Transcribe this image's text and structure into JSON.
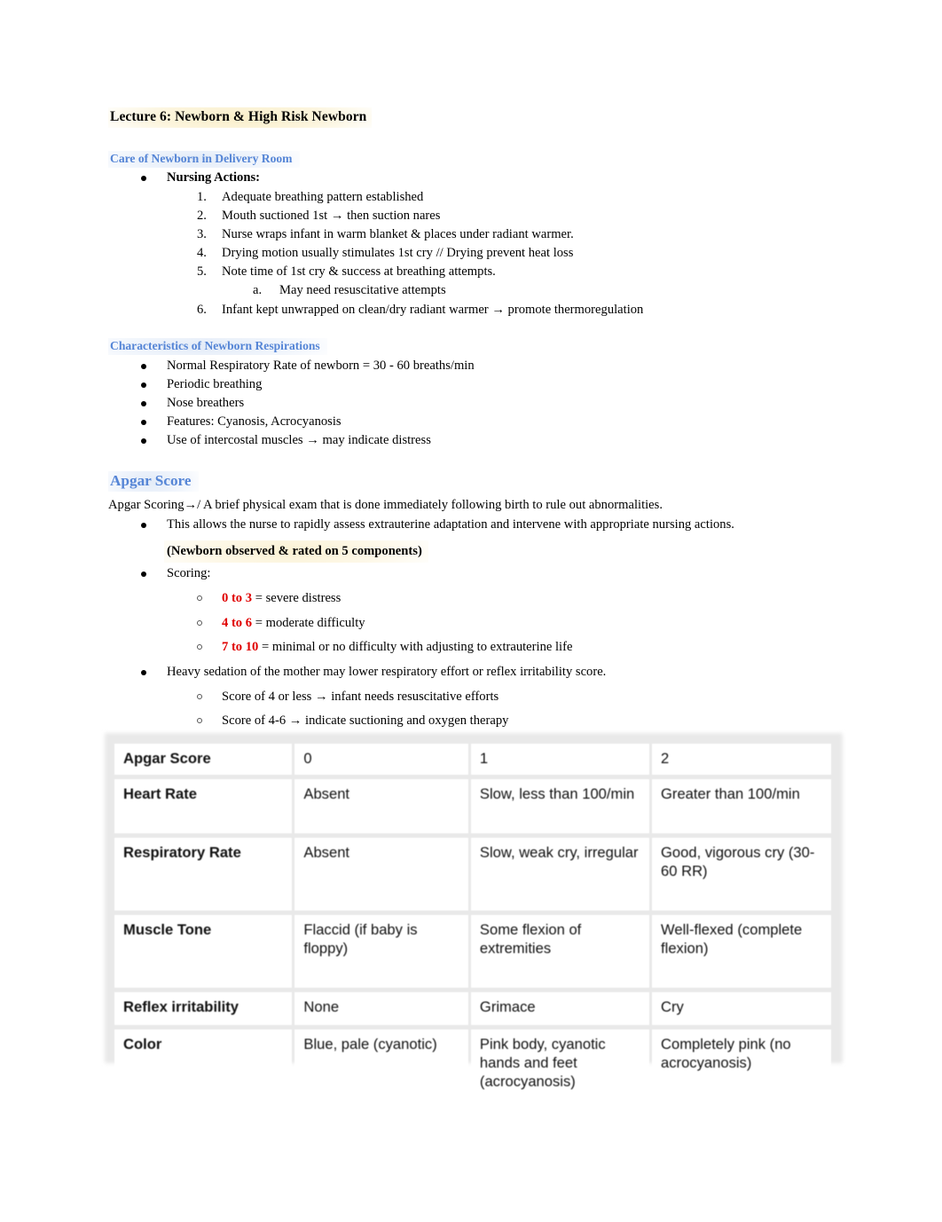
{
  "document": {
    "title": "Lecture 6: Newborn & High Risk Newborn"
  },
  "sections": [
    {
      "heading": "Care of Newborn in Delivery Room",
      "bullet_label": "Nursing Actions:",
      "numbered": [
        "Adequate breathing pattern established",
        "Mouth suctioned 1st → then suction nares",
        "Nurse wraps infant in warm blanket & places under radiant warmer.",
        "Drying motion usually stimulates 1st cry // Drying prevent heat loss",
        "Note time of 1st cry & success at breathing attempts.",
        "Infant kept unwrapped on clean/dry radiant warmer → promote thermoregulation"
      ],
      "sub_a": "May need resuscitative attempts",
      "sub_a_marker": "a."
    },
    {
      "heading": "Characteristics of Newborn Respirations",
      "bullets": [
        "Normal Respiratory Rate of newborn = 30 - 60 breaths/min",
        "Periodic breathing",
        "Nose breathers",
        "Features: Cyanosis, Acrocyanosis",
        "Use of intercostal muscles → may indicate distress"
      ]
    },
    {
      "heading": "Apgar Score",
      "definition_term": "Apgar Scoring",
      "definition_rest": "→/ A brief physical exam that is done immediately following birth to rule out abnormalities.",
      "bullet_1": "This allows the nurse to rapidly assess extrauterine adaptation and intervene with appropriate nursing actions.",
      "highlight_note": "(Newborn observed & rated on 5 components)",
      "scoring_label": "Scoring",
      "scoring_colon": ":",
      "scoring_items": [
        {
          "range": "0 to 3",
          "text": " = severe distress"
        },
        {
          "range": "4 to 6",
          "text": " = moderate difficulty"
        },
        {
          "range": "7 to 10",
          "text": " = minimal or no difficulty with adjusting to extrauterine life"
        }
      ],
      "sedation_note": "Heavy sedation of the mother may lower respiratory effort or reflex irritability score.",
      "sedation_items": [
        {
          "bold": "Score of 4 or less",
          "text": " → infant needs resuscitative efforts"
        },
        {
          "bold": "Score of 4-6",
          "text": " → indicate suctioning and oxygen therapy"
        }
      ]
    }
  ],
  "apgar_table": {
    "header": [
      "Apgar Score",
      "0",
      "1",
      "2"
    ],
    "rows": [
      [
        "Heart Rate",
        "Absent",
        "Slow, less than 100/min",
        "Greater than 100/min"
      ],
      [
        "Respiratory Rate",
        "Absent",
        "Slow, weak cry, irregular",
        "Good, vigorous cry (30-60 RR)"
      ],
      [
        "Muscle Tone",
        "Flaccid (if baby is floppy)",
        "Some flexion of extremities",
        "Well-flexed (complete flexion)"
      ],
      [
        "Reflex irritability",
        "None",
        "Grimace",
        "Cry"
      ],
      [
        "Color",
        "Blue, pale (cyanotic)",
        "Pink body, cyanotic hands and feet (acrocyanosis)",
        "Completely pink (no acrocyanosis)"
      ]
    ]
  },
  "colors": {
    "heading_blue": "#5585D6",
    "score_red": "#E00000",
    "highlight_yellow": "#FBF1D0",
    "highlight_blue": "#E1EAF7"
  }
}
